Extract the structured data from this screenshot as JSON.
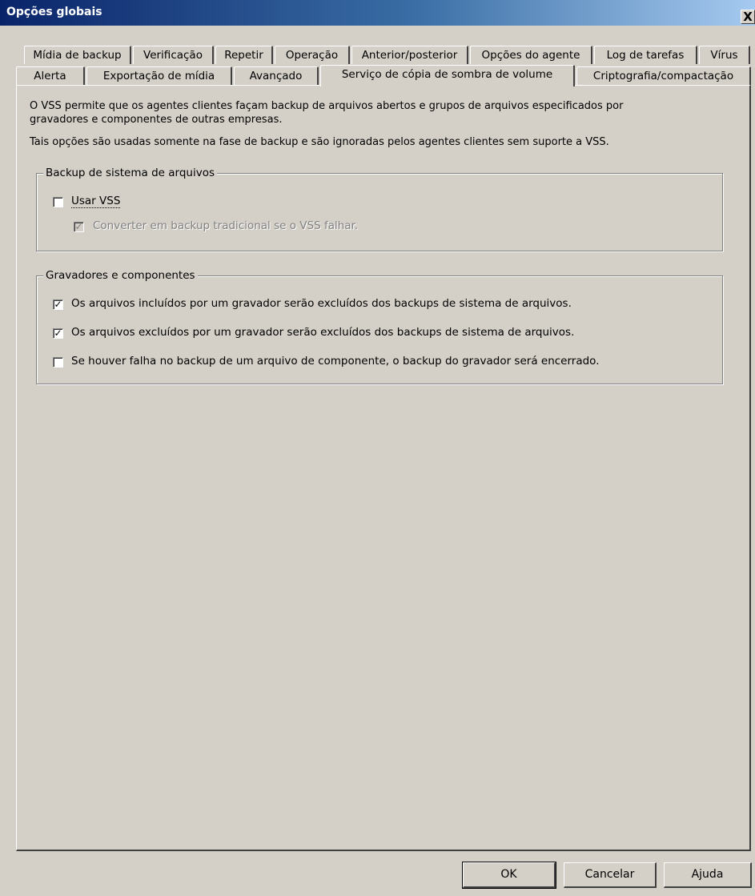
{
  "window": {
    "title": "Opções globais",
    "close": "X"
  },
  "tabs_row1": [
    "Mídia de backup",
    "Verificação",
    "Repetir",
    "Operação",
    "Anterior/posterior",
    "Opções do agente",
    "Log de tarefas",
    "Vírus"
  ],
  "tabs_row2": [
    "Alerta",
    "Exportação de mídia",
    "Avançado",
    "Serviço de cópia de sombra de volume",
    "Criptografia/compactação"
  ],
  "active_tab": "Serviço de cópia de sombra de volume",
  "description": {
    "line1": "O VSS permite que os agentes clientes façam backup de arquivos abertos e grupos de arquivos especificados por",
    "line2": "gravadores e componentes de outras empresas.",
    "line3": "Tais opções são usadas somente na fase de backup e são ignoradas pelos agentes clientes sem suporte a VSS."
  },
  "fs_group": {
    "title": "Backup de sistema de arquivos",
    "use_vss": {
      "label": "Usar VSS",
      "checked": false
    },
    "fallback": {
      "label": "Converter em backup tradicional se o VSS falhar.",
      "checked": true,
      "enabled": false
    }
  },
  "writers_group": {
    "title": "Gravadores e componentes",
    "options": [
      {
        "label": "Os arquivos incluídos por um gravador serão excluídos dos backups de sistema de arquivos.",
        "checked": true
      },
      {
        "label": "Os arquivos excluídos por um gravador serão excluídos dos backups de sistema de arquivos.",
        "checked": true
      },
      {
        "label": "Se houver falha no backup de um arquivo de componente, o backup do gravador será encerrado.",
        "checked": false
      }
    ]
  },
  "buttons": {
    "ok": "OK",
    "cancel": "Cancelar",
    "help": "Ajuda"
  },
  "check_mark": "✓"
}
